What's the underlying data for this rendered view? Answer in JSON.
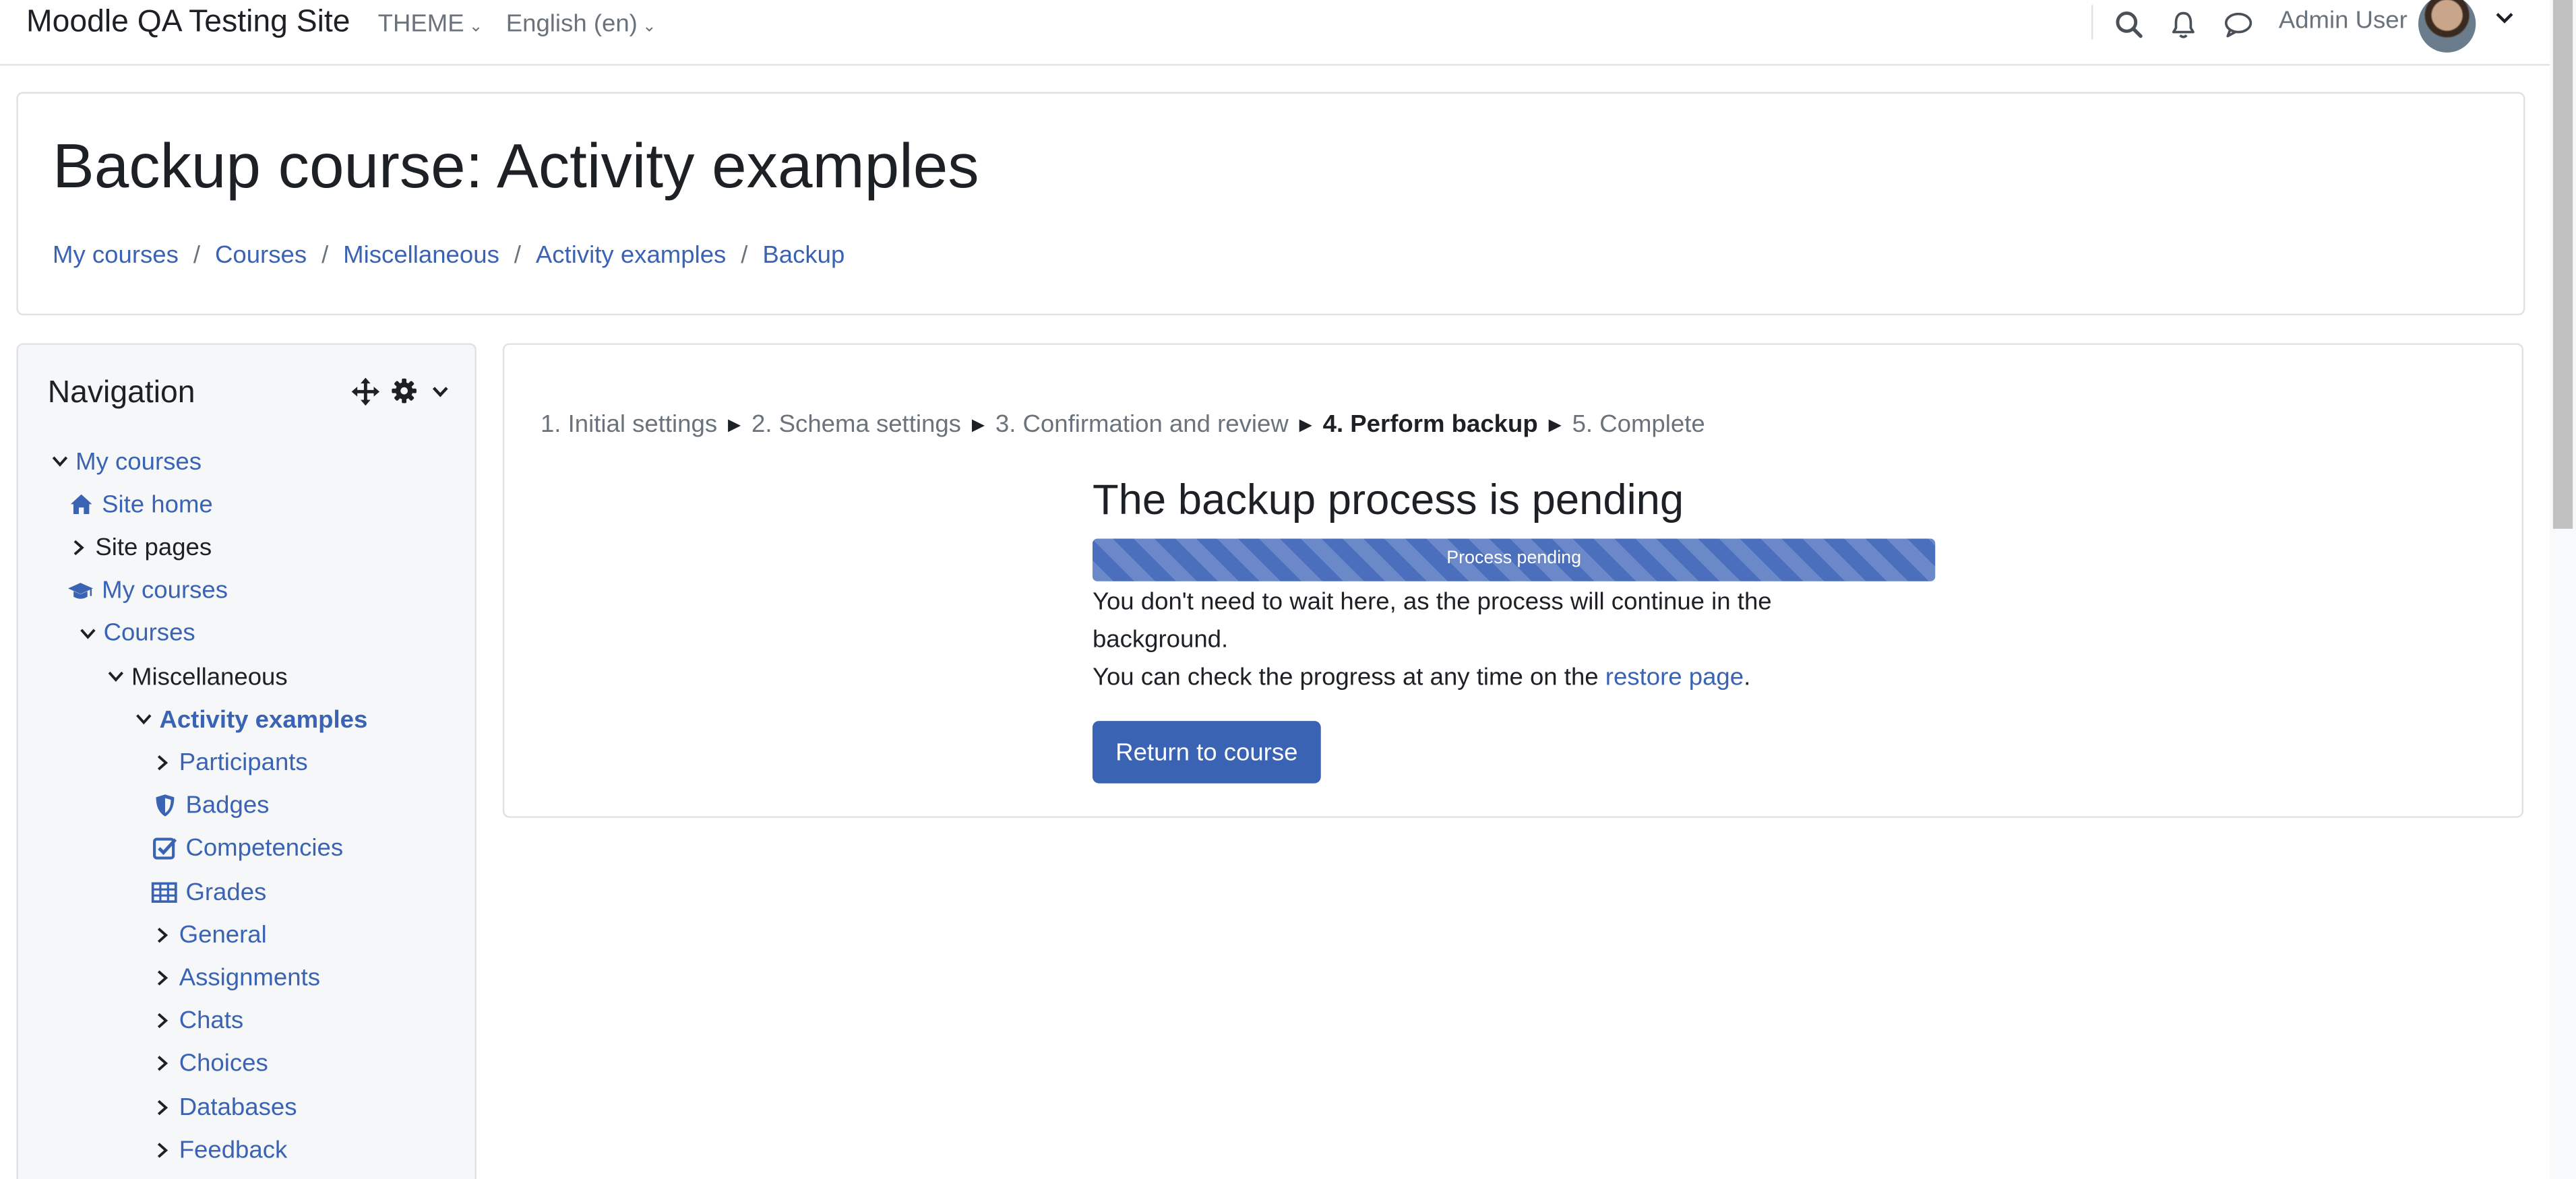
{
  "navbar": {
    "site_name": "Moodle QA Testing Site",
    "theme_label": "THEME",
    "language_label": "English (en)",
    "user_name": "Admin User",
    "icons": [
      "search-icon",
      "bell-icon",
      "chat-icon",
      "chevron-down-icon"
    ]
  },
  "header": {
    "title": "Backup course: Activity examples",
    "breadcrumbs": [
      "My courses",
      "Courses",
      "Miscellaneous",
      "Activity examples",
      "Backup"
    ],
    "separator": "/"
  },
  "navigation_block": {
    "title": "Navigation",
    "items": [
      {
        "label": "My courses",
        "toggle": "expanded",
        "icon": "",
        "style": "link"
      },
      {
        "label": "Site home",
        "toggle": "",
        "icon": "home-icon",
        "style": "link"
      },
      {
        "label": "Site pages",
        "toggle": "collapsed",
        "icon": "",
        "style": "plain"
      },
      {
        "label": "My courses",
        "toggle": "",
        "icon": "graduation-cap-icon",
        "style": "link"
      },
      {
        "label": "Courses",
        "toggle": "expanded",
        "icon": "",
        "style": "link"
      },
      {
        "label": "Miscellaneous",
        "toggle": "expanded",
        "icon": "",
        "style": "plain"
      },
      {
        "label": "Activity examples",
        "toggle": "expanded",
        "icon": "",
        "style": "link-bold"
      },
      {
        "label": "Participants",
        "toggle": "collapsed",
        "icon": "",
        "style": "link"
      },
      {
        "label": "Badges",
        "toggle": "",
        "icon": "shield-icon",
        "style": "link"
      },
      {
        "label": "Competencies",
        "toggle": "",
        "icon": "checkbox-icon",
        "style": "link"
      },
      {
        "label": "Grades",
        "toggle": "",
        "icon": "table-icon",
        "style": "link"
      },
      {
        "label": "General",
        "toggle": "collapsed",
        "icon": "",
        "style": "link"
      },
      {
        "label": "Assignments",
        "toggle": "collapsed",
        "icon": "",
        "style": "link"
      },
      {
        "label": "Chats",
        "toggle": "collapsed",
        "icon": "",
        "style": "link"
      },
      {
        "label": "Choices",
        "toggle": "collapsed",
        "icon": "",
        "style": "link"
      },
      {
        "label": "Databases",
        "toggle": "collapsed",
        "icon": "",
        "style": "link"
      },
      {
        "label": "Feedback",
        "toggle": "collapsed",
        "icon": "",
        "style": "link"
      }
    ]
  },
  "backup": {
    "steps": [
      "1. Initial settings",
      "2. Schema settings",
      "3. Confirmation and review",
      "4. Perform backup",
      "5. Complete"
    ],
    "step_arrow": "►",
    "current_step": 3,
    "title": "The backup process is pending",
    "progress_label": "Process pending",
    "progress_value": 0,
    "message_line1": "You don't need to wait here, as the process will continue in the background.",
    "message_line2_prefix": "You can check the progress at any time on the",
    "restore_link": "restore page",
    "message_line2_suffix": ".",
    "return_button": "Return to course"
  },
  "colors": {
    "link": "#3b63b4",
    "primary_button": "#3b63b4",
    "muted_text": "#6a737b"
  }
}
